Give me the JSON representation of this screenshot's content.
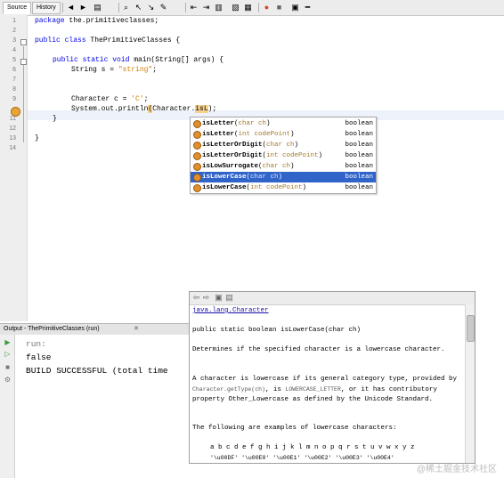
{
  "toolbar": {
    "tabs": [
      "Source",
      "History"
    ],
    "icons": [
      "back-icon",
      "forward-icon",
      "search-icon",
      "find-prev-icon",
      "find-next-icon",
      "toggle-highlight-icon",
      "shift-left-icon",
      "shift-right-icon",
      "comment-icon",
      "uncomment-icon",
      "record-macro-icon",
      "stop-macro-icon",
      "toggle-bookmark-icon"
    ]
  },
  "editor": {
    "line_numbers": [
      "1",
      "2",
      "3",
      "4",
      "5",
      "6",
      "7",
      "8",
      "9",
      "10",
      "11",
      "12",
      "13",
      "14"
    ],
    "code": {
      "l1_kw": "package",
      "l1_rest": " the.primitiveclasses;",
      "l3_kw": "public class",
      "l3_rest": " ThePrimitiveClasses {",
      "l5_kw": "public static void",
      "l5_rest": " main(String[] args) {",
      "l6_pre": "String s = ",
      "l6_str": "\"string\"",
      "l6_post": ";",
      "l9_pre": "Character c = ",
      "l9_str": "'C'",
      "l9_post": ";",
      "l10_pre": "System.out.println",
      "l10_paren": "(",
      "l10_mid": "Character.",
      "l10_typed": "isL",
      "l10_post": ");",
      "l11": "}",
      "l13": "}"
    }
  },
  "completion": {
    "items": [
      {
        "name": "isLetter",
        "open": "(",
        "param": "char ch",
        "close": ")",
        "type": "boolean",
        "selected": false
      },
      {
        "name": "isLetter",
        "open": "(",
        "param": "int codePoint",
        "close": ")",
        "type": "boolean",
        "selected": false
      },
      {
        "name": "isLetterOrDigit",
        "open": "(",
        "param": "char ch",
        "close": ")",
        "type": "boolean",
        "selected": false
      },
      {
        "name": "isLetterOrDigit",
        "open": "(",
        "param": "int codePoint",
        "close": ")",
        "type": "boolean",
        "selected": false
      },
      {
        "name": "isLowSurrogate",
        "open": "(",
        "param": "char ch",
        "close": ")",
        "type": "boolean",
        "selected": false
      },
      {
        "name": "isLowerCase",
        "open": "(",
        "param": "char ch",
        "close": ")",
        "type": "boolean",
        "selected": true
      },
      {
        "name": "isLowerCase",
        "open": "(",
        "param": "int codePoint",
        "close": ")",
        "type": "boolean",
        "selected": false
      }
    ]
  },
  "javadoc": {
    "class_link": "java.lang.Character",
    "signature": "public static boolean isLowerCase(char ch)",
    "desc": "Determines if the specified character is a lowercase character.",
    "para_a": "A character is lowercase if its general category type, provided by",
    "para_code1": "Character.getType(ch)",
    "para_b": ", is",
    "para_code2": "LOWERCASE_LETTER",
    "para_c": ", or it has contributory property Other_Lowercase as defined by the Unicode Standard.",
    "examples_intro": "The following are examples of lowercase characters:",
    "examples_letters": "a b c d e f g h i j k l m n o p q r s t u v w x y z",
    "examples_codes": "'\\u00DF' '\\u00E0' '\\u00E1' '\\u00E2' '\\u00E3' '\\u00E4'"
  },
  "output": {
    "title": "Output - ThePrimitiveClasses (run)",
    "close": "✕",
    "lines": [
      "run:",
      "false",
      "BUILD SUCCESSFUL (total time"
    ]
  },
  "watermark": "@稀土掘金技术社区",
  "colors": {
    "selection": "#3064c8",
    "keyword": "#0000e6",
    "string": "#ce7b00"
  }
}
